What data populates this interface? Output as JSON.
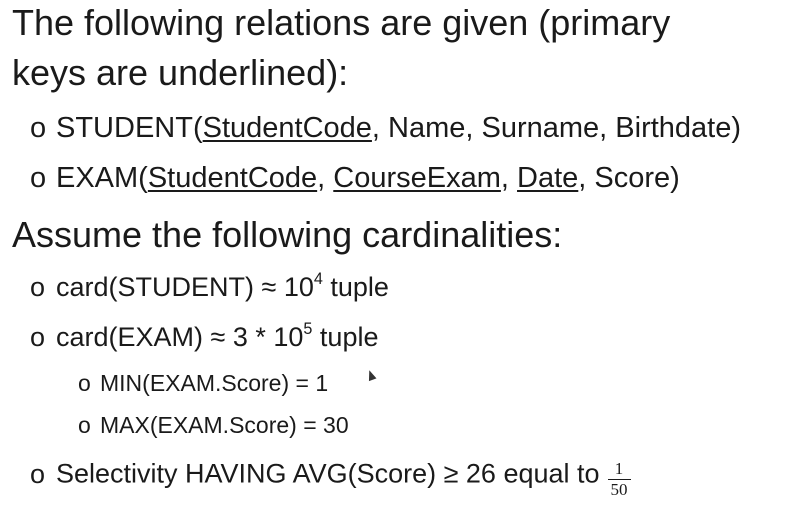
{
  "heading1": "The following relations are given (primary",
  "heading1_cont": "keys are underlined):",
  "bullet_glyph": "o",
  "student": {
    "prefix": "STUDENT(",
    "key": "StudentCode",
    "rest": ", Name, Surname, Birthdate)"
  },
  "exam": {
    "prefix": "EXAM(",
    "key1": "StudentCode",
    "sep1": ", ",
    "key2": "CourseExam",
    "sep2": ", ",
    "key3": "Date",
    "rest": ", Score)"
  },
  "heading2": "Assume the following cardinalities:",
  "card_student": {
    "prefix": "card(STUDENT) ≈ 10",
    "exp": "4",
    "suffix": " tuple"
  },
  "card_exam": {
    "prefix": "card(EXAM) ≈ 3 * 10",
    "exp": "5",
    "suffix": " tuple"
  },
  "min_score": "MIN(EXAM.Score) = 1",
  "max_score": "MAX(EXAM.Score) = 30",
  "selectivity": {
    "text": "Selectivity HAVING AVG(Score) ≥ 26 equal to",
    "numerator": "1",
    "denominator": "50"
  }
}
